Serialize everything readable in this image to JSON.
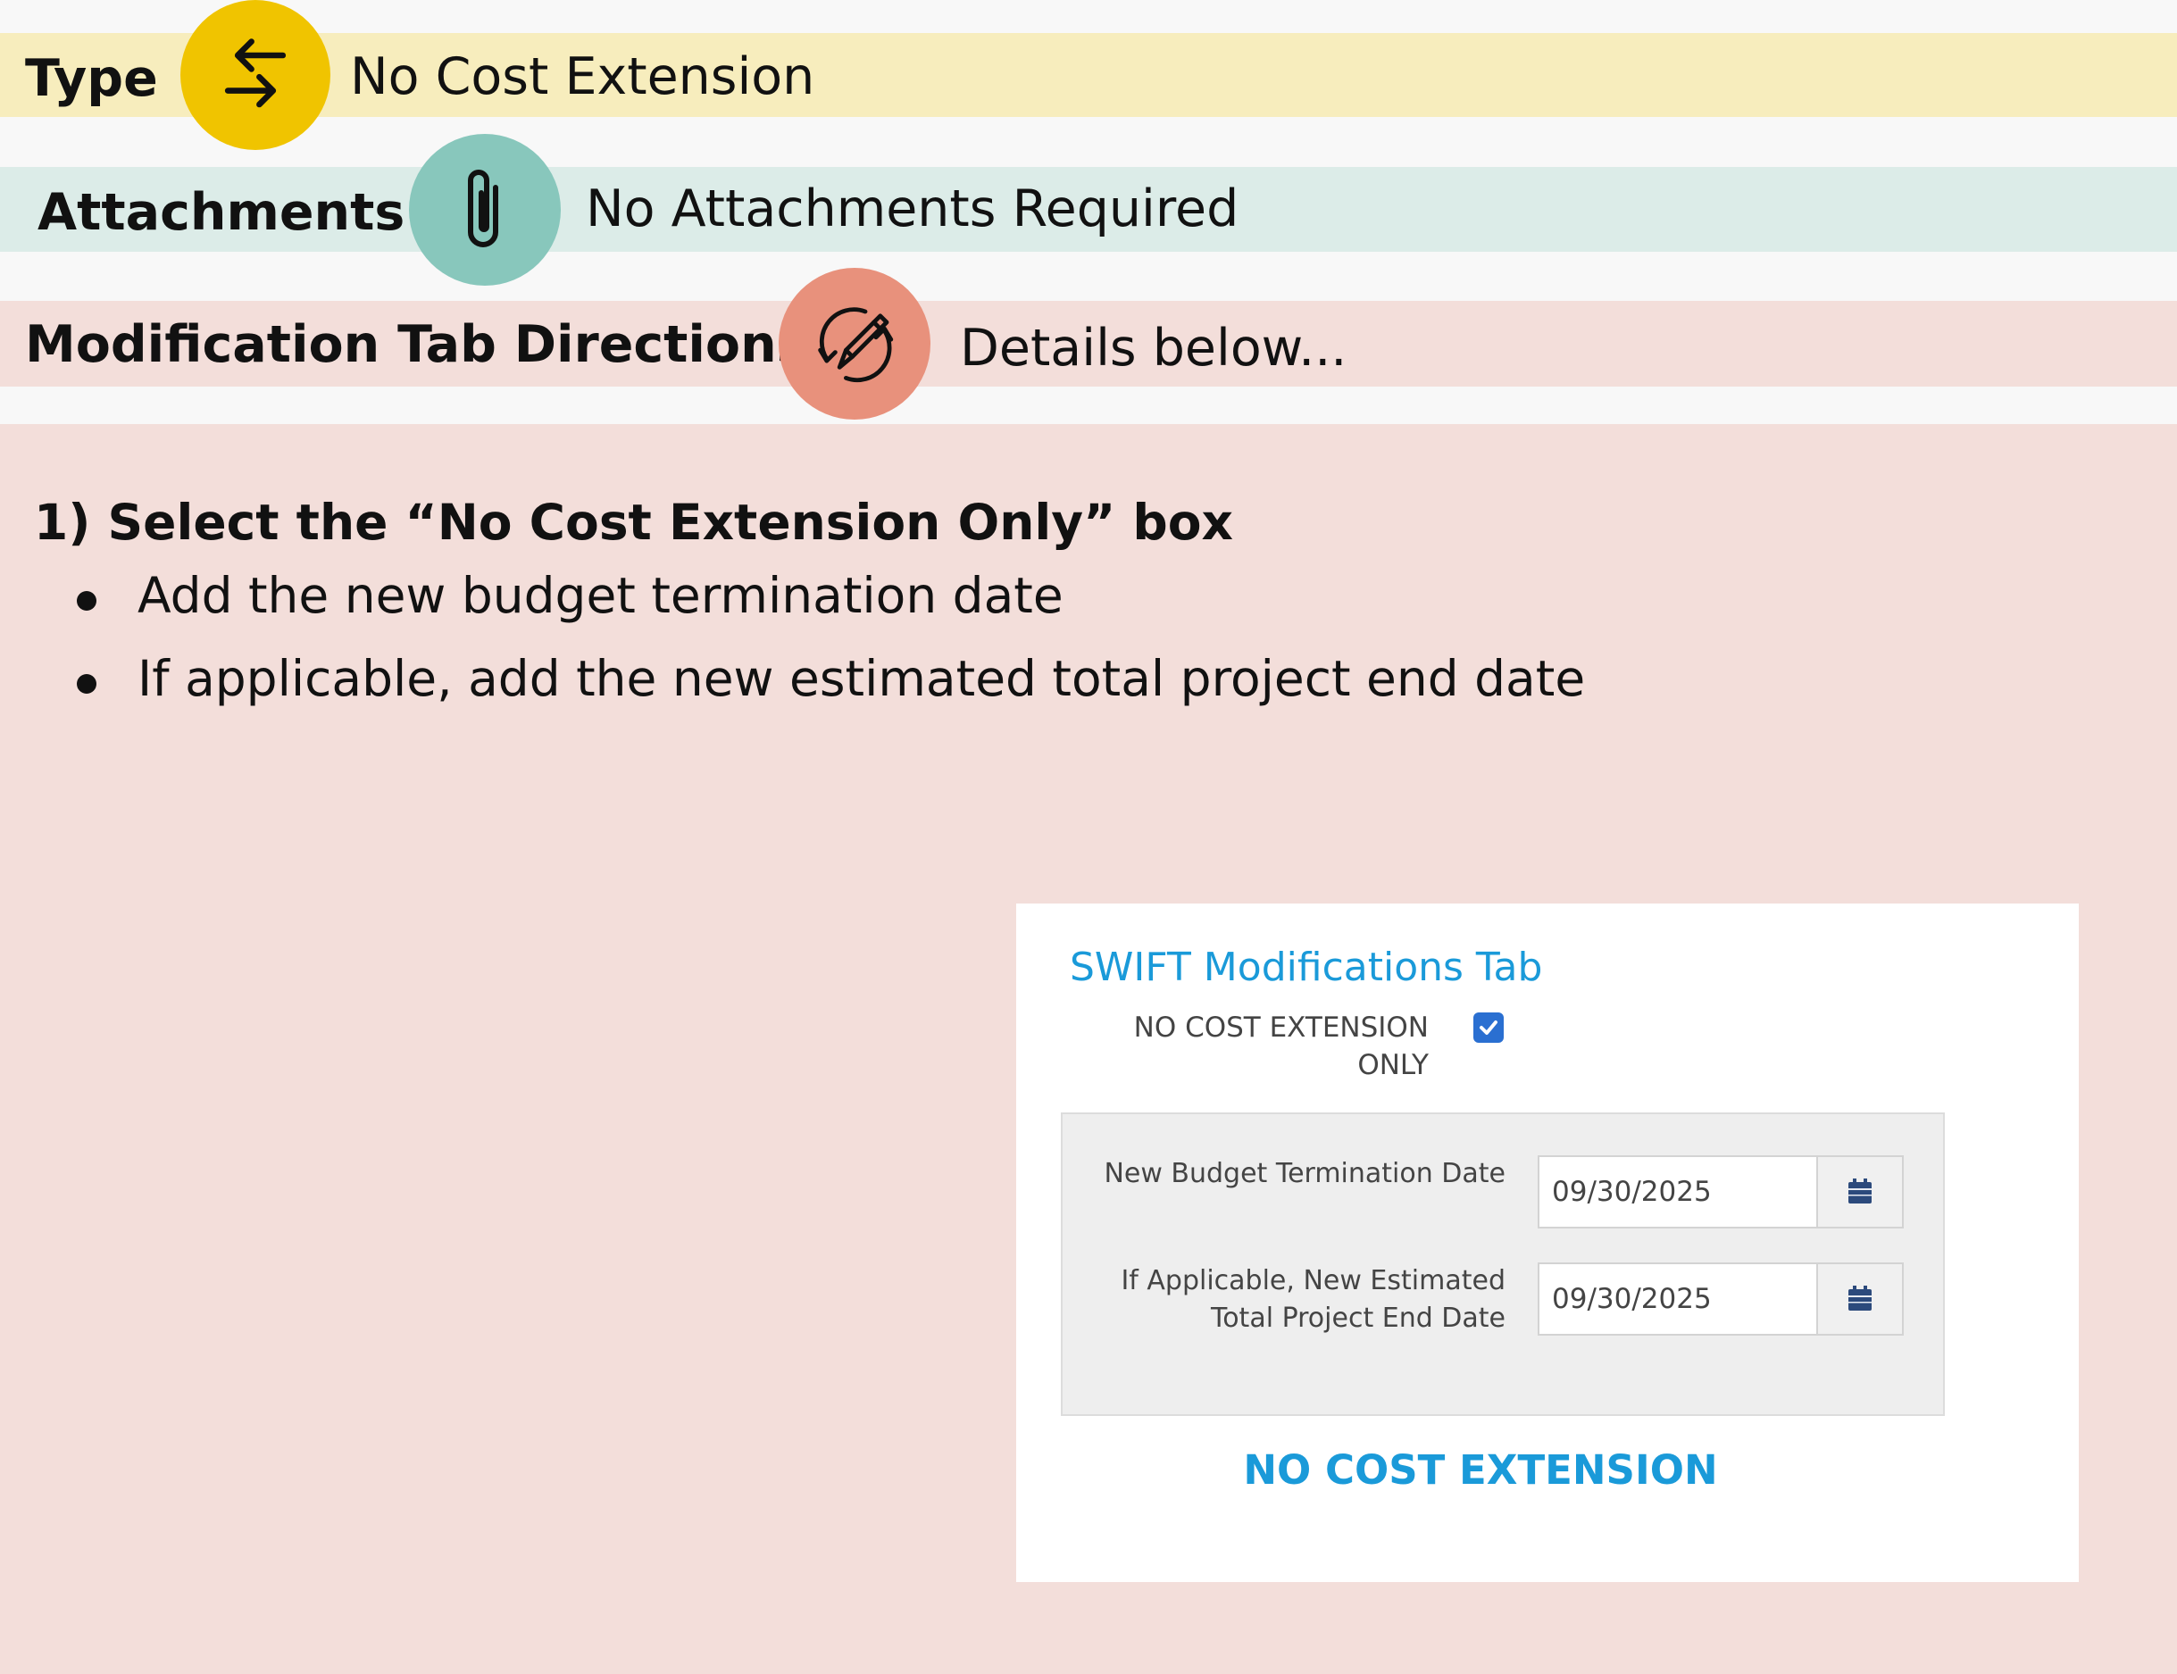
{
  "rows": {
    "type": {
      "label": "Type",
      "value": "No Cost Extension",
      "icon": "arrows-exchange-icon",
      "color": "#f0c400"
    },
    "attachments": {
      "label": "Attachments",
      "value": "No Attachments Required",
      "icon": "paperclip-icon",
      "color": "#88c7bc"
    },
    "modification": {
      "label": "Modification Tab Directions",
      "value": "Details below...",
      "icon": "pencil-refresh-icon",
      "color": "#e8917c"
    }
  },
  "instructions": {
    "step1": "1) Select the “No Cost Extension Only” box",
    "bullets": [
      "Add the new budget termination date",
      "If applicable, add the new estimated total project end date"
    ]
  },
  "swift": {
    "title": "SWIFT Modifications Tab",
    "checkbox_label_line1": "NO COST EXTENSION",
    "checkbox_label_line2": "ONLY",
    "checkbox_checked": "true",
    "field1_label": "New Budget Termination Date",
    "field1_value": "09/30/2025",
    "field2_label_line1": "If Applicable, New Estimated",
    "field2_label_line2": "Total Project End Date",
    "field2_value": "09/30/2025",
    "footer": "NO COST EXTENSION",
    "accent": "#1a9ad9"
  }
}
